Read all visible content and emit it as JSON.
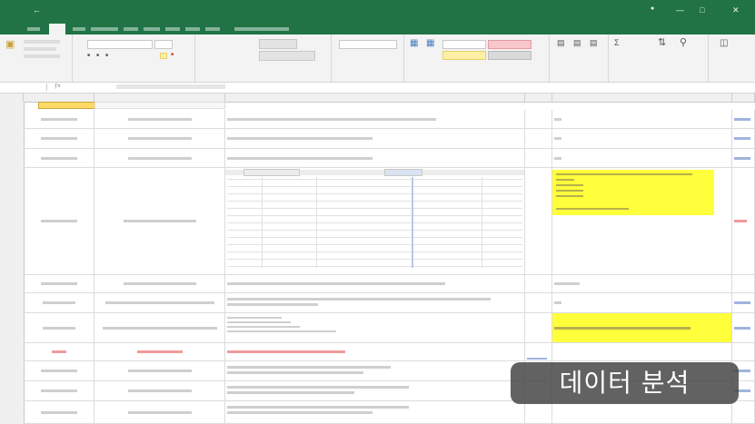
{
  "caption": "데이터 분석"
}
